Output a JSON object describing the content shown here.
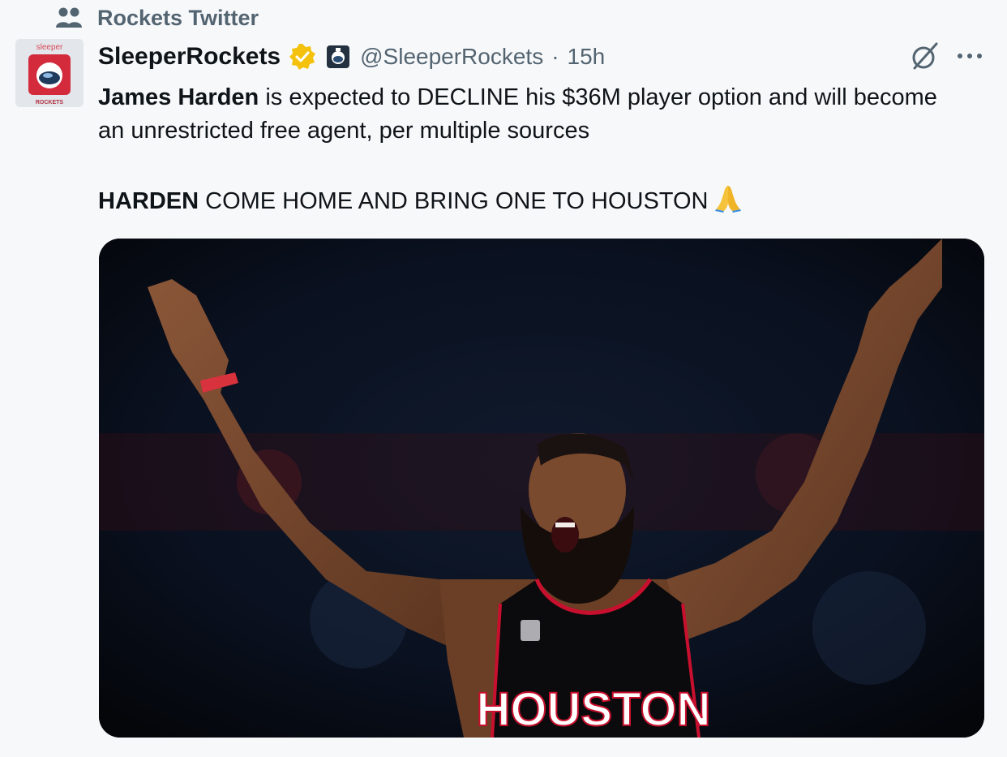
{
  "community": {
    "name": "Rockets Twitter",
    "icon": "community-people-icon"
  },
  "tweet": {
    "author": {
      "display_name": "SleeperRockets",
      "handle": "@SleeperRockets",
      "verified_color": "#f4c20d",
      "avatar_label_top": "sleeper",
      "avatar_label_bottom": "ROCKETS"
    },
    "separator": "·",
    "time": "15h",
    "text": {
      "p1_bold": "James Harden",
      "p1_rest": " is expected to DECLINE his $36M player option and will become an unrestricted free agent, per multiple sources",
      "p2_bold": "HARDEN",
      "p2_rest": " COME HOME AND BRING ONE TO HOUSTON",
      "emoji": "folded-hands-icon"
    },
    "media": {
      "jersey_text": "HOUSTON",
      "jersey_color": "#0b0b0d",
      "trim_color": "#c8102e"
    }
  },
  "actions": {
    "grok": "grok-icon",
    "more": "more-icon"
  },
  "colors": {
    "background": "#f7f8fa",
    "secondary_text": "#536471",
    "primary_text": "#0f1419"
  }
}
